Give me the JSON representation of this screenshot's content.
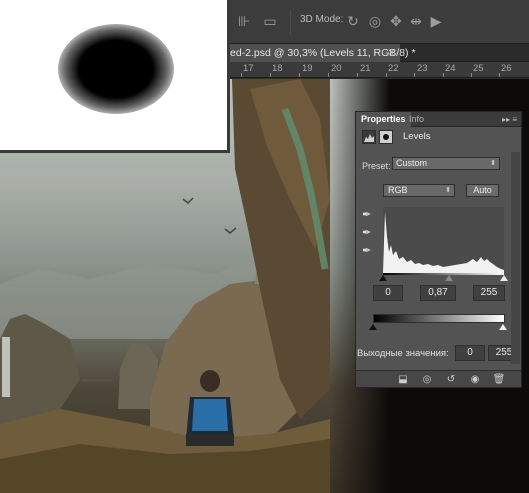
{
  "options_bar": {
    "mode_3d_label": "3D Mode:",
    "icons": [
      "align-icon",
      "rotate-3d-icon",
      "roll-3d-icon",
      "pan-3d-icon",
      "slide-3d-icon",
      "scale-3d-icon"
    ]
  },
  "document": {
    "tab_title": "ed-2.psd @ 30,3% (Levels 11, RGB/8) *",
    "close_glyph": "×"
  },
  "ruler": {
    "numbers": [
      "17",
      "18",
      "19",
      "20",
      "21",
      "22",
      "23",
      "24",
      "25",
      "26"
    ]
  },
  "properties_panel": {
    "tabs": [
      "Properties",
      "Info"
    ],
    "menu_glyph": "▸▸ ≡",
    "adjustment_title": "Levels",
    "preset_label": "Preset:",
    "preset_value": "Custom",
    "channel_value": "RGB",
    "auto_label": "Auto",
    "input_black": "0",
    "input_gamma": "0,87",
    "input_white": "255",
    "output_label": "Выходные значения:",
    "output_black": "0",
    "output_white": "255"
  },
  "colors": {
    "panel_bg": "#535353",
    "ui_dark": "#2b2b2b",
    "accent_blue": "#3a7ab8"
  }
}
